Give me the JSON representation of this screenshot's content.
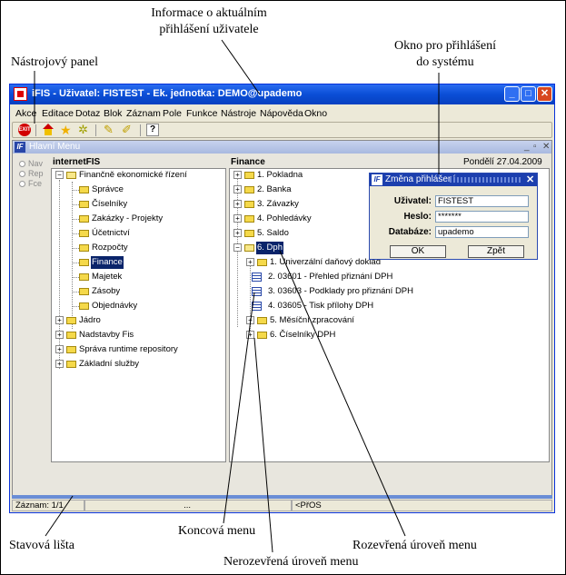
{
  "annotations": {
    "top_line1": "Informace o aktuálním",
    "top_line2": "přihlášení uživatele",
    "toolbar": "Nástrojový panel",
    "login_line1": "Okno pro přihlášení",
    "login_line2": "do systému",
    "statusbar": "Stavová lišta",
    "leaf_menu": "Koncová menu",
    "expanded": "Rozevřená úroveň menu",
    "collapsed": "Nerozevřená úroveň menu"
  },
  "window": {
    "title": "iFIS - Uživatel: FISTEST - Ek. jednotka: DEMO@upademo"
  },
  "menu": [
    "Akce",
    "Editace",
    "Dotaz",
    "Blok",
    "Záznam",
    "Pole",
    "Funkce",
    "Nástroje",
    "Nápověda",
    "Okno"
  ],
  "toolbar_icons": {
    "exit_label": "EXIT",
    "help_label": "?"
  },
  "inner": {
    "title": "Hlavní Menu",
    "date": "Pondělí 27.04.2009"
  },
  "sidenav": [
    "Nav",
    "Rep",
    "Fce"
  ],
  "left_pane": {
    "header": "internetFIS",
    "root": "Finančně ekonomické řízení",
    "children": [
      "Správce",
      "Číselníky",
      "Zakázky - Projekty",
      "Účetnictví",
      "Rozpočty",
      "Finance",
      "Majetek",
      "Zásoby",
      "Objednávky"
    ],
    "selected": "Finance",
    "others": [
      "Jádro",
      "Nadstavby Fis",
      "Správa runtime repository",
      "Základní služby"
    ]
  },
  "right_pane": {
    "header": "Finance",
    "items": [
      "1.  Pokladna",
      "2.  Banka",
      "3.  Závazky",
      "4.  Pohledávky",
      "5.  Saldo"
    ],
    "open": "6.  Dph",
    "subitems": [
      "1.  Univerzální daňový doklad",
      "2.  03601 - Přehled přiznání DPH",
      "3.  03603 - Podklady pro přiznání DPH",
      "4.  03605 - Tisk přílohy DPH",
      "5.  Měsíční zpracování",
      "6.  Číselníky DPH"
    ]
  },
  "status": {
    "record": "Záznam: 1/1",
    "dots": "...",
    "mode": "<PřOS"
  },
  "dialog": {
    "title": "Změna přihlášení",
    "user_label": "Uživatel:",
    "user_value": "FISTEST",
    "pass_label": "Heslo:",
    "pass_value": "*******",
    "db_label": "Databáze:",
    "db_value": "upademo",
    "ok": "OK",
    "back": "Zpět"
  }
}
